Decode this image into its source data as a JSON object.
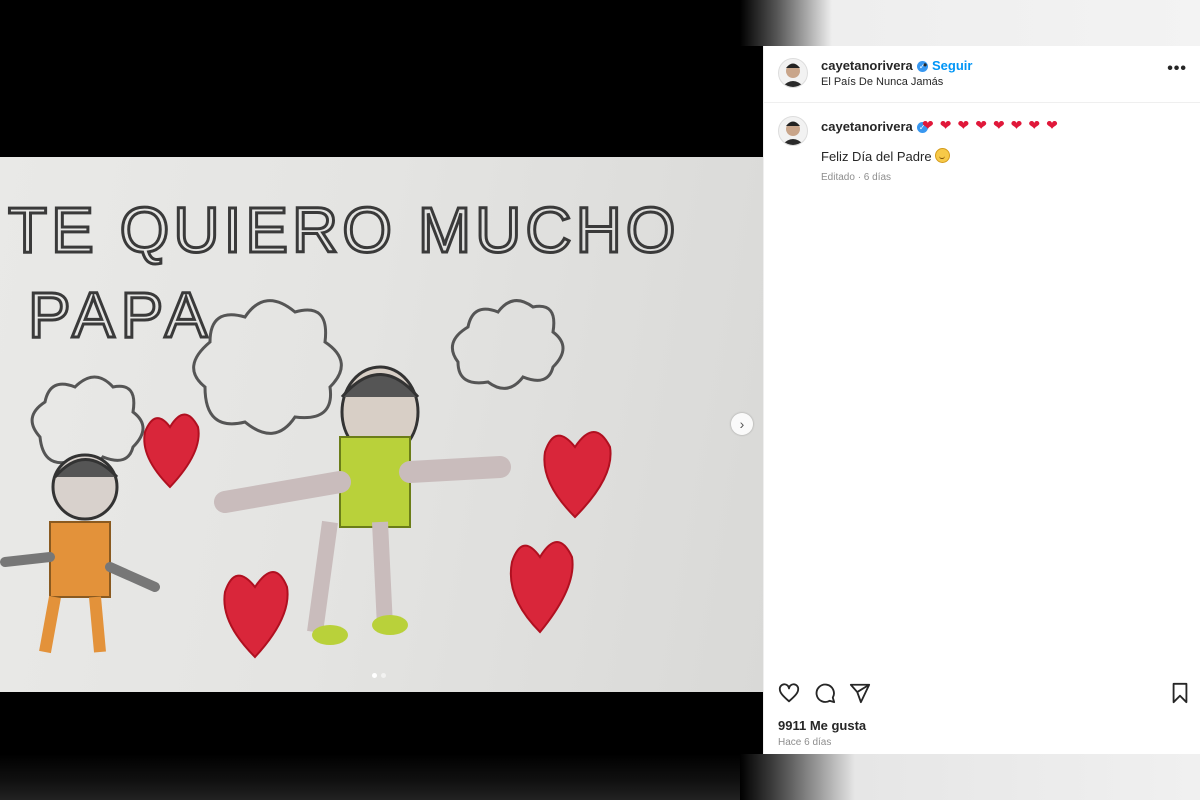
{
  "post": {
    "username": "cayetanorivera",
    "verified_symbol": "✓",
    "follow_label": "Seguir",
    "separator": "•",
    "location": "El País De Nunca Jamás",
    "more_label": "•••",
    "caption_username": "cayetanorivera",
    "caption_hearts": [
      "❤",
      "❤",
      "❤",
      "❤",
      "❤",
      "❤",
      "❤",
      "❤"
    ],
    "caption_text": "Feliz Día del Padre",
    "caption_meta": "Editado · 6 días",
    "likes": "9911 Me gusta",
    "time_ago": "Hace 6 días"
  },
  "media": {
    "drawing_lines": [
      "TE QUIERO  MUCHO",
      "PAPA"
    ],
    "carousel": {
      "slides": 2,
      "active_index": 0
    },
    "next_symbol": "›"
  },
  "icons": {
    "like": "heart-outline-icon",
    "comment": "comment-bubble-icon",
    "share": "paper-plane-icon",
    "save": "bookmark-icon"
  },
  "colors": {
    "follow": "#0095f6",
    "heart": "#e0183a",
    "verified": "#3897f0"
  }
}
